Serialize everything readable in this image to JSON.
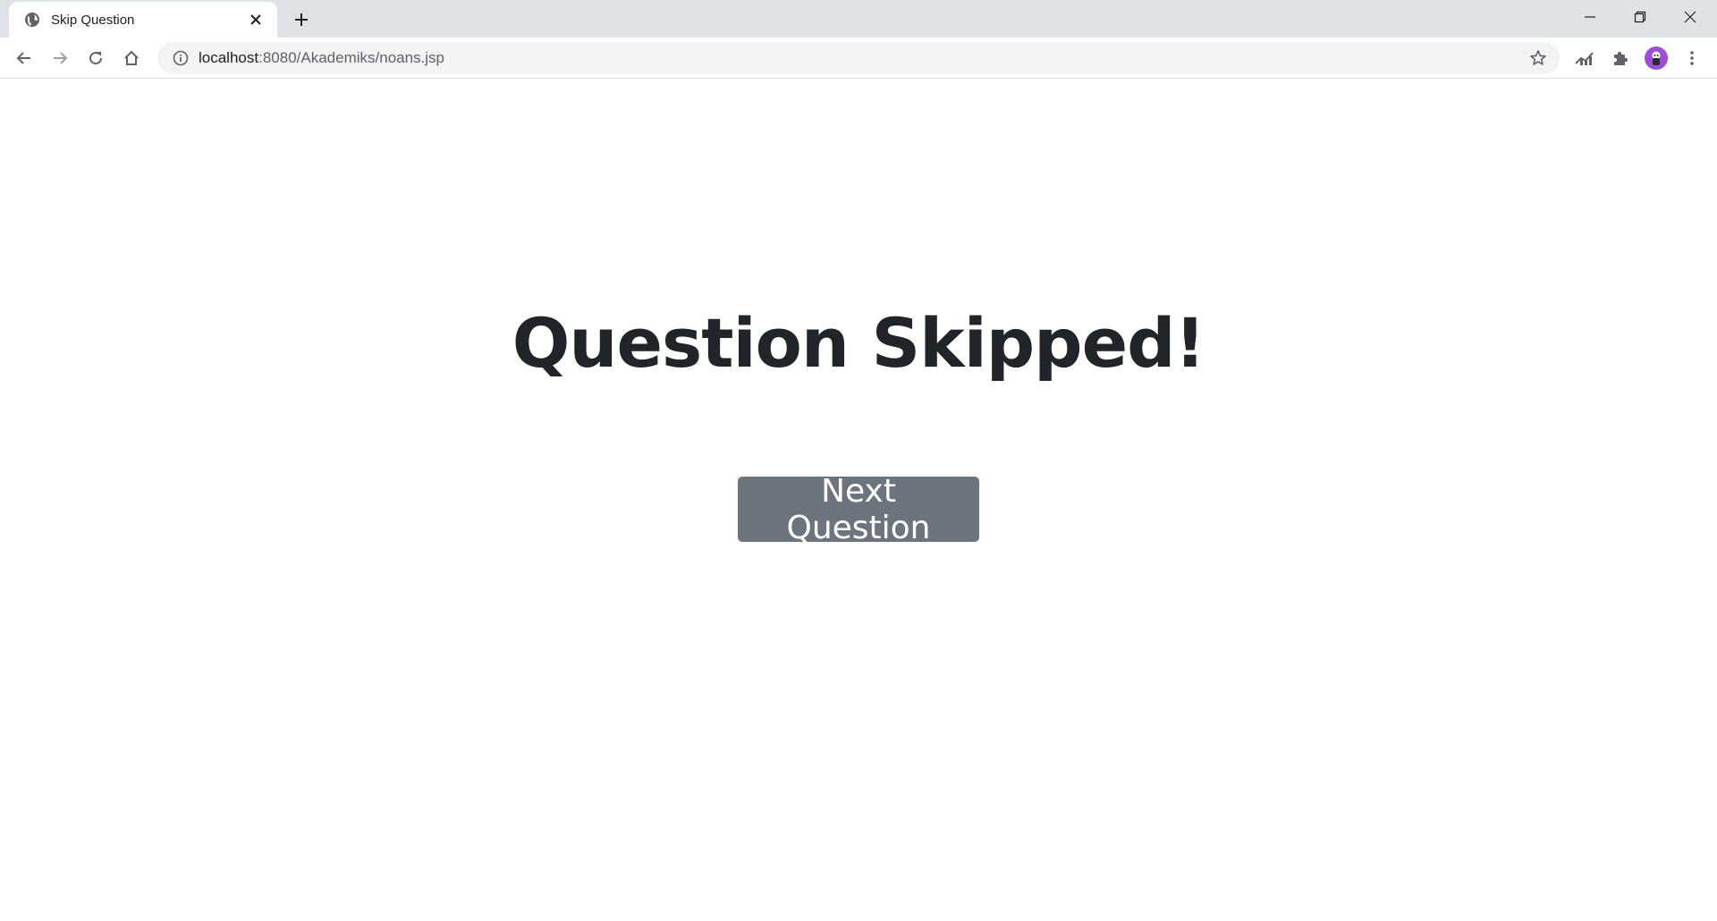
{
  "browser": {
    "tab": {
      "title": "Skip Question",
      "favicon": "globe-icon"
    },
    "address_bar": {
      "host": "localhost",
      "path": ":8080/Akademiks/noans.jsp"
    },
    "icons": {
      "back": "arrow-left-icon",
      "forward": "arrow-right-icon",
      "reload": "reload-icon",
      "home": "home-icon",
      "info": "info-icon",
      "bookmark": "star-icon",
      "extension_1": "chart-extension-icon",
      "extensions": "puzzle-icon",
      "profile": "avatar",
      "menu": "kebab-menu-icon"
    }
  },
  "page": {
    "heading": "Question Skipped!",
    "next_button_label": "Next Question"
  },
  "colors": {
    "heading": "#212529",
    "button_bg": "#6c757d",
    "button_text": "#ffffff",
    "tabstrip_bg": "#dee1e6",
    "omnibox_bg": "#f1f3f4",
    "avatar_bg": "#9c4fd6"
  }
}
